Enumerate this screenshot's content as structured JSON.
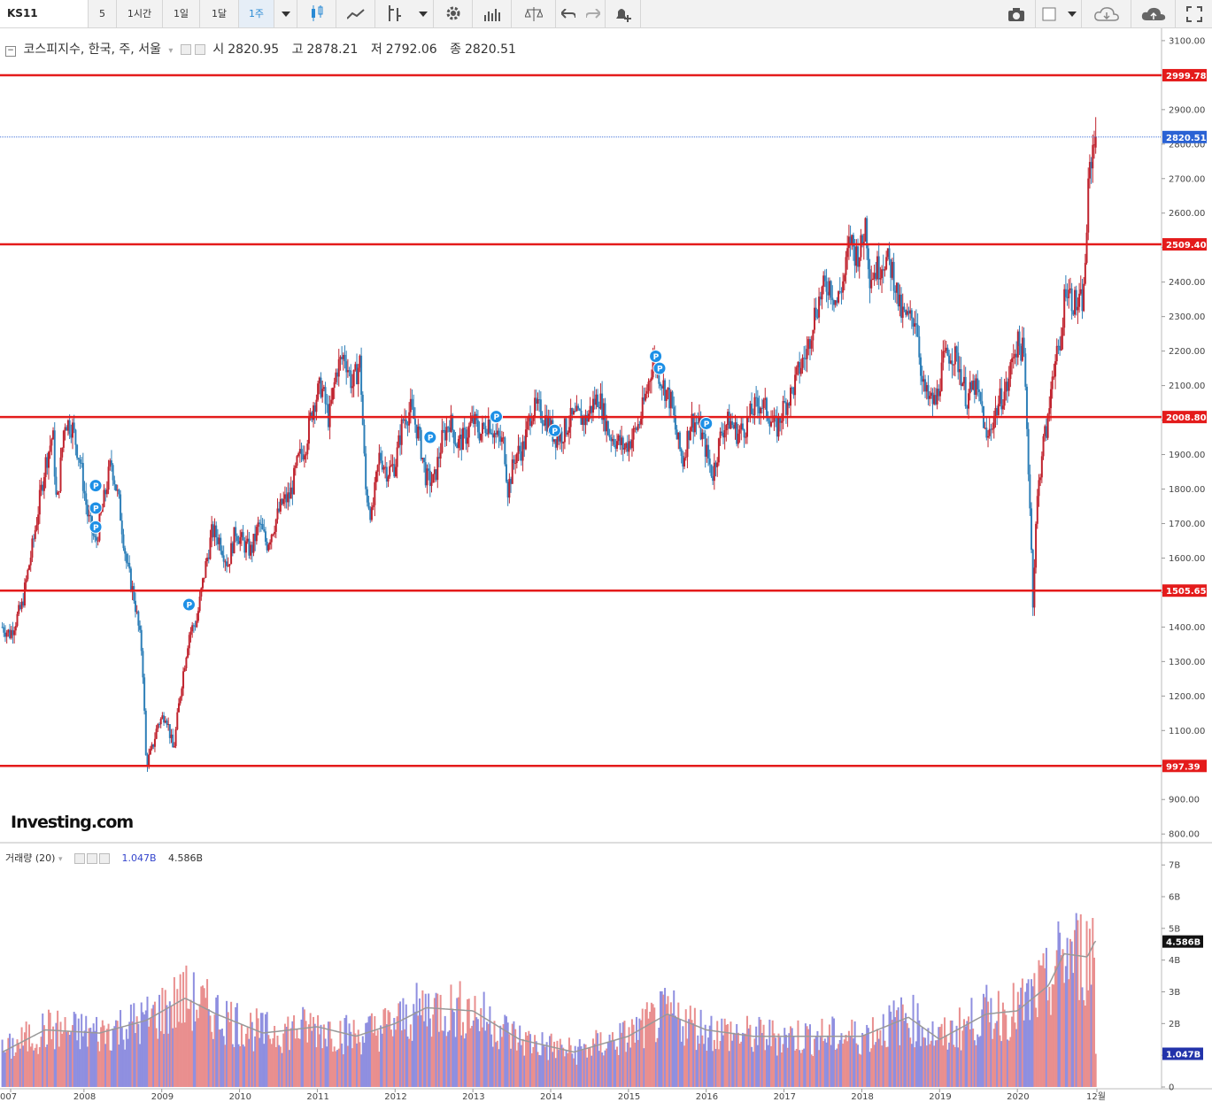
{
  "toolbar": {
    "symbol": "KS11",
    "intervals": [
      "5",
      "1시간",
      "1일",
      "1달",
      "1주"
    ],
    "active_interval": "1주"
  },
  "legend": {
    "title": "코스피지수, 한국, 주, 서울",
    "open_label": "시",
    "open": "2820.95",
    "high_label": "고",
    "high": "2878.21",
    "low_label": "저",
    "low": "2792.06",
    "close_label": "종",
    "close": "2820.51"
  },
  "volume_legend": {
    "title": "거래량 (20)",
    "value1": "1.047B",
    "value2": "4.586B"
  },
  "watermark": "Investing.com",
  "colors": {
    "up": "#c0232e",
    "down": "#2e7fb8",
    "level_line": "#e41b1b",
    "price_tag": "#2a62d4",
    "marker": "#1e90e6",
    "volume_up": "#e98f8f",
    "volume_down": "#8f8fe0"
  },
  "chart_data": {
    "type": "candlestick",
    "price_axis": {
      "ticks": [
        "3100.00",
        "3000.00",
        "2900.00",
        "2800.00",
        "2700.00",
        "2600.00",
        "2500.00",
        "2400.00",
        "2300.00",
        "2200.00",
        "2100.00",
        "2000.00",
        "1900.00",
        "1800.00",
        "1700.00",
        "1600.00",
        "1500.00",
        "1400.00",
        "1300.00",
        "1200.00",
        "1100.00",
        "1000.00",
        "900.00",
        "800.00"
      ],
      "range": [
        780,
        3110
      ]
    },
    "levels": [
      "2999.78",
      "2509.40",
      "2008.80",
      "1505.65",
      "997.39"
    ],
    "current_price": "2820.51",
    "time_axis": [
      "007",
      "2008",
      "2009",
      "2010",
      "2011",
      "2012",
      "2013",
      "2014",
      "2015",
      "2016",
      "2017",
      "2018",
      "2019",
      "2020",
      "12월"
    ],
    "weekly_closes": [
      {
        "t": 2006.95,
        "v": 1400
      },
      {
        "t": 2007.05,
        "v": 1380
      },
      {
        "t": 2007.2,
        "v": 1460
      },
      {
        "t": 2007.35,
        "v": 1650
      },
      {
        "t": 2007.5,
        "v": 1870
      },
      {
        "t": 2007.6,
        "v": 1960
      },
      {
        "t": 2007.65,
        "v": 1740
      },
      {
        "t": 2007.75,
        "v": 2000
      },
      {
        "t": 2007.85,
        "v": 1980
      },
      {
        "t": 2007.95,
        "v": 1880
      },
      {
        "t": 2008.05,
        "v": 1720
      },
      {
        "t": 2008.15,
        "v": 1640
      },
      {
        "t": 2008.25,
        "v": 1760
      },
      {
        "t": 2008.35,
        "v": 1880
      },
      {
        "t": 2008.45,
        "v": 1760
      },
      {
        "t": 2008.55,
        "v": 1580
      },
      {
        "t": 2008.65,
        "v": 1480
      },
      {
        "t": 2008.75,
        "v": 1320
      },
      {
        "t": 2008.8,
        "v": 1000
      },
      {
        "t": 2008.88,
        "v": 1050
      },
      {
        "t": 2008.95,
        "v": 1120
      },
      {
        "t": 2009.05,
        "v": 1150
      },
      {
        "t": 2009.15,
        "v": 1040
      },
      {
        "t": 2009.25,
        "v": 1230
      },
      {
        "t": 2009.35,
        "v": 1380
      },
      {
        "t": 2009.45,
        "v": 1420
      },
      {
        "t": 2009.55,
        "v": 1560
      },
      {
        "t": 2009.65,
        "v": 1680
      },
      {
        "t": 2009.75,
        "v": 1650
      },
      {
        "t": 2009.85,
        "v": 1580
      },
      {
        "t": 2009.95,
        "v": 1680
      },
      {
        "t": 2010.05,
        "v": 1640
      },
      {
        "t": 2010.15,
        "v": 1620
      },
      {
        "t": 2010.25,
        "v": 1700
      },
      {
        "t": 2010.35,
        "v": 1640
      },
      {
        "t": 2010.45,
        "v": 1700
      },
      {
        "t": 2010.55,
        "v": 1760
      },
      {
        "t": 2010.65,
        "v": 1780
      },
      {
        "t": 2010.75,
        "v": 1880
      },
      {
        "t": 2010.85,
        "v": 1930
      },
      {
        "t": 2010.95,
        "v": 2050
      },
      {
        "t": 2011.05,
        "v": 2100
      },
      {
        "t": 2011.15,
        "v": 2000
      },
      {
        "t": 2011.25,
        "v": 2150
      },
      {
        "t": 2011.35,
        "v": 2190
      },
      {
        "t": 2011.45,
        "v": 2100
      },
      {
        "t": 2011.55,
        "v": 2170
      },
      {
        "t": 2011.62,
        "v": 1800
      },
      {
        "t": 2011.7,
        "v": 1720
      },
      {
        "t": 2011.8,
        "v": 1900
      },
      {
        "t": 2011.9,
        "v": 1850
      },
      {
        "t": 2012.0,
        "v": 1870
      },
      {
        "t": 2012.1,
        "v": 2000
      },
      {
        "t": 2012.2,
        "v": 2030
      },
      {
        "t": 2012.3,
        "v": 1960
      },
      {
        "t": 2012.4,
        "v": 1830
      },
      {
        "t": 2012.5,
        "v": 1820
      },
      {
        "t": 2012.6,
        "v": 1940
      },
      {
        "t": 2012.7,
        "v": 2000
      },
      {
        "t": 2012.8,
        "v": 1930
      },
      {
        "t": 2012.9,
        "v": 1950
      },
      {
        "t": 2013.0,
        "v": 2000
      },
      {
        "t": 2013.1,
        "v": 1960
      },
      {
        "t": 2013.2,
        "v": 2000
      },
      {
        "t": 2013.3,
        "v": 1950
      },
      {
        "t": 2013.4,
        "v": 1930
      },
      {
        "t": 2013.45,
        "v": 1800
      },
      {
        "t": 2013.55,
        "v": 1900
      },
      {
        "t": 2013.65,
        "v": 1920
      },
      {
        "t": 2013.75,
        "v": 2030
      },
      {
        "t": 2013.85,
        "v": 2030
      },
      {
        "t": 2013.95,
        "v": 2000
      },
      {
        "t": 2014.05,
        "v": 1950
      },
      {
        "t": 2014.15,
        "v": 1960
      },
      {
        "t": 2014.25,
        "v": 2000
      },
      {
        "t": 2014.35,
        "v": 2010
      },
      {
        "t": 2014.45,
        "v": 2000
      },
      {
        "t": 2014.55,
        "v": 2050
      },
      {
        "t": 2014.62,
        "v": 2070
      },
      {
        "t": 2014.75,
        "v": 1960
      },
      {
        "t": 2014.85,
        "v": 1940
      },
      {
        "t": 2014.95,
        "v": 1920
      },
      {
        "t": 2015.05,
        "v": 1950
      },
      {
        "t": 2015.15,
        "v": 2000
      },
      {
        "t": 2015.25,
        "v": 2100
      },
      {
        "t": 2015.32,
        "v": 2180
      },
      {
        "t": 2015.45,
        "v": 2100
      },
      {
        "t": 2015.55,
        "v": 2050
      },
      {
        "t": 2015.62,
        "v": 1950
      },
      {
        "t": 2015.7,
        "v": 1880
      },
      {
        "t": 2015.8,
        "v": 2000
      },
      {
        "t": 2015.9,
        "v": 1990
      },
      {
        "t": 2016.0,
        "v": 1910
      },
      {
        "t": 2016.08,
        "v": 1840
      },
      {
        "t": 2016.2,
        "v": 1970
      },
      {
        "t": 2016.3,
        "v": 2000
      },
      {
        "t": 2016.4,
        "v": 1960
      },
      {
        "t": 2016.5,
        "v": 1980
      },
      {
        "t": 2016.6,
        "v": 2030
      },
      {
        "t": 2016.7,
        "v": 2050
      },
      {
        "t": 2016.8,
        "v": 2020
      },
      {
        "t": 2016.9,
        "v": 1970
      },
      {
        "t": 2017.0,
        "v": 2040
      },
      {
        "t": 2017.1,
        "v": 2080
      },
      {
        "t": 2017.2,
        "v": 2150
      },
      {
        "t": 2017.3,
        "v": 2200
      },
      {
        "t": 2017.38,
        "v": 2300
      },
      {
        "t": 2017.48,
        "v": 2370
      },
      {
        "t": 2017.58,
        "v": 2400
      },
      {
        "t": 2017.68,
        "v": 2340
      },
      {
        "t": 2017.78,
        "v": 2420
      },
      {
        "t": 2017.85,
        "v": 2530
      },
      {
        "t": 2017.92,
        "v": 2480
      },
      {
        "t": 2018.0,
        "v": 2500
      },
      {
        "t": 2018.05,
        "v": 2580
      },
      {
        "t": 2018.1,
        "v": 2420
      },
      {
        "t": 2018.2,
        "v": 2440
      },
      {
        "t": 2018.3,
        "v": 2470
      },
      {
        "t": 2018.4,
        "v": 2430
      },
      {
        "t": 2018.5,
        "v": 2310
      },
      {
        "t": 2018.6,
        "v": 2290
      },
      {
        "t": 2018.7,
        "v": 2300
      },
      {
        "t": 2018.78,
        "v": 2100
      },
      {
        "t": 2018.85,
        "v": 2060
      },
      {
        "t": 2018.95,
        "v": 2050
      },
      {
        "t": 2019.05,
        "v": 2170
      },
      {
        "t": 2019.15,
        "v": 2200
      },
      {
        "t": 2019.25,
        "v": 2160
      },
      {
        "t": 2019.35,
        "v": 2060
      },
      {
        "t": 2019.45,
        "v": 2100
      },
      {
        "t": 2019.55,
        "v": 2030
      },
      {
        "t": 2019.6,
        "v": 1930
      },
      {
        "t": 2019.68,
        "v": 2000
      },
      {
        "t": 2019.78,
        "v": 2060
      },
      {
        "t": 2019.88,
        "v": 2100
      },
      {
        "t": 2019.95,
        "v": 2200
      },
      {
        "t": 2020.0,
        "v": 2220
      },
      {
        "t": 2020.08,
        "v": 2200
      },
      {
        "t": 2020.12,
        "v": 2000
      },
      {
        "t": 2020.17,
        "v": 1700
      },
      {
        "t": 2020.2,
        "v": 1480
      },
      {
        "t": 2020.25,
        "v": 1750
      },
      {
        "t": 2020.32,
        "v": 1920
      },
      {
        "t": 2020.4,
        "v": 2000
      },
      {
        "t": 2020.45,
        "v": 2150
      },
      {
        "t": 2020.55,
        "v": 2200
      },
      {
        "t": 2020.62,
        "v": 2400
      },
      {
        "t": 2020.7,
        "v": 2350
      },
      {
        "t": 2020.78,
        "v": 2330
      },
      {
        "t": 2020.85,
        "v": 2350
      },
      {
        "t": 2020.88,
        "v": 2500
      },
      {
        "t": 2020.92,
        "v": 2700
      },
      {
        "t": 2020.96,
        "v": 2780
      },
      {
        "t": 2021.0,
        "v": 2820
      }
    ],
    "markers": [
      {
        "t": 2008.15,
        "v": 1810
      },
      {
        "t": 2008.15,
        "v": 1745
      },
      {
        "t": 2008.15,
        "v": 1690
      },
      {
        "t": 2009.35,
        "v": 1465
      },
      {
        "t": 2012.45,
        "v": 1950
      },
      {
        "t": 2013.3,
        "v": 2010
      },
      {
        "t": 2014.05,
        "v": 1970
      },
      {
        "t": 2015.35,
        "v": 2185
      },
      {
        "t": 2015.4,
        "v": 2150
      },
      {
        "t": 2016.0,
        "v": 1990
      }
    ],
    "volume_axis": {
      "ticks": [
        "7B",
        "6B",
        "5B",
        "4B",
        "3B",
        "2B",
        "1B",
        "0"
      ],
      "range_billions": [
        0,
        7.2
      ]
    },
    "volume_tags": [
      "4.586B",
      "1.047B"
    ],
    "volume_level": [
      {
        "t": 2006.95,
        "v": 1.1
      },
      {
        "t": 2007.5,
        "v": 1.8
      },
      {
        "t": 2008.2,
        "v": 1.7
      },
      {
        "t": 2008.8,
        "v": 2.1
      },
      {
        "t": 2009.3,
        "v": 2.8
      },
      {
        "t": 2009.7,
        "v": 2.3
      },
      {
        "t": 2010.3,
        "v": 1.7
      },
      {
        "t": 2011.0,
        "v": 1.9
      },
      {
        "t": 2011.5,
        "v": 1.6
      },
      {
        "t": 2012.0,
        "v": 2.0
      },
      {
        "t": 2012.4,
        "v": 2.5
      },
      {
        "t": 2013.0,
        "v": 2.4
      },
      {
        "t": 2013.6,
        "v": 1.5
      },
      {
        "t": 2014.3,
        "v": 1.1
      },
      {
        "t": 2015.0,
        "v": 1.6
      },
      {
        "t": 2015.5,
        "v": 2.3
      },
      {
        "t": 2016.0,
        "v": 1.8
      },
      {
        "t": 2016.6,
        "v": 1.6
      },
      {
        "t": 2017.3,
        "v": 1.6
      },
      {
        "t": 2018.0,
        "v": 1.6
      },
      {
        "t": 2018.6,
        "v": 2.2
      },
      {
        "t": 2019.0,
        "v": 1.5
      },
      {
        "t": 2019.6,
        "v": 2.3
      },
      {
        "t": 2020.0,
        "v": 2.4
      },
      {
        "t": 2020.4,
        "v": 3.2
      },
      {
        "t": 2020.6,
        "v": 4.2
      },
      {
        "t": 2020.9,
        "v": 4.1
      },
      {
        "t": 2021.0,
        "v": 4.6
      }
    ]
  }
}
